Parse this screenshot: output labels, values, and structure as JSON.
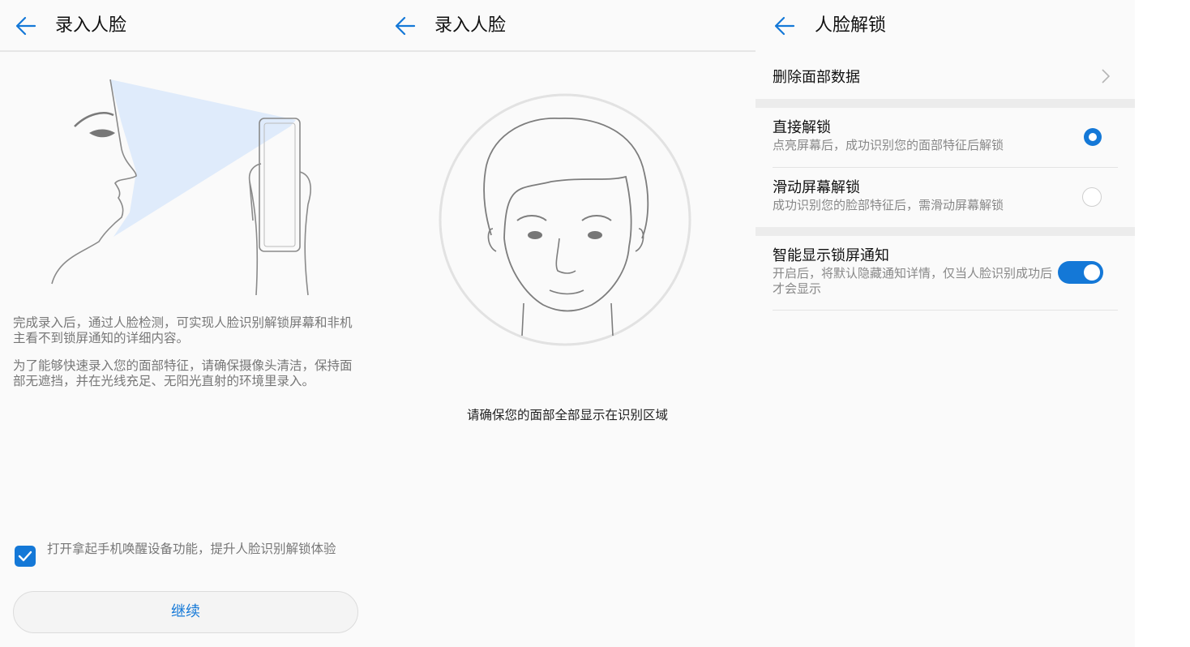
{
  "colors": {
    "accent": "#1478d7",
    "background": "#fafafa"
  },
  "panel1": {
    "title": "录入人脸",
    "description_1": "完成录入后，通过人脸检测，可实现人脸识别解锁屏幕和非机主看不到锁屏通知的详细内容。",
    "description_2": "为了能够快速录入您的面部特征，请确保摄像头清洁，保持面部无遮挡，并在光线充足、无阳光直射的环境里录入。",
    "checkbox_label": "打开拿起手机唤醒设备功能，提升人脸识别解锁体验",
    "checkbox_checked": true,
    "continue_label": "继续"
  },
  "panel2": {
    "title": "录入人脸",
    "hint": "请确保您的面部全部显示在识别区域"
  },
  "panel3": {
    "title": "人脸解锁",
    "delete_label": "删除面部数据",
    "options": [
      {
        "title": "直接解锁",
        "subtitle": "点亮屏幕后，成功识别您的面部特征后解锁",
        "selected": true
      },
      {
        "title": "滑动屏幕解锁",
        "subtitle": "成功识别您的脸部特征后，需滑动屏幕解锁",
        "selected": false
      }
    ],
    "notify": {
      "title": "智能显示锁屏通知",
      "subtitle": "开启后，将默认隐藏通知详情，仅当人脸识别成功后才会显示",
      "enabled": true
    }
  }
}
